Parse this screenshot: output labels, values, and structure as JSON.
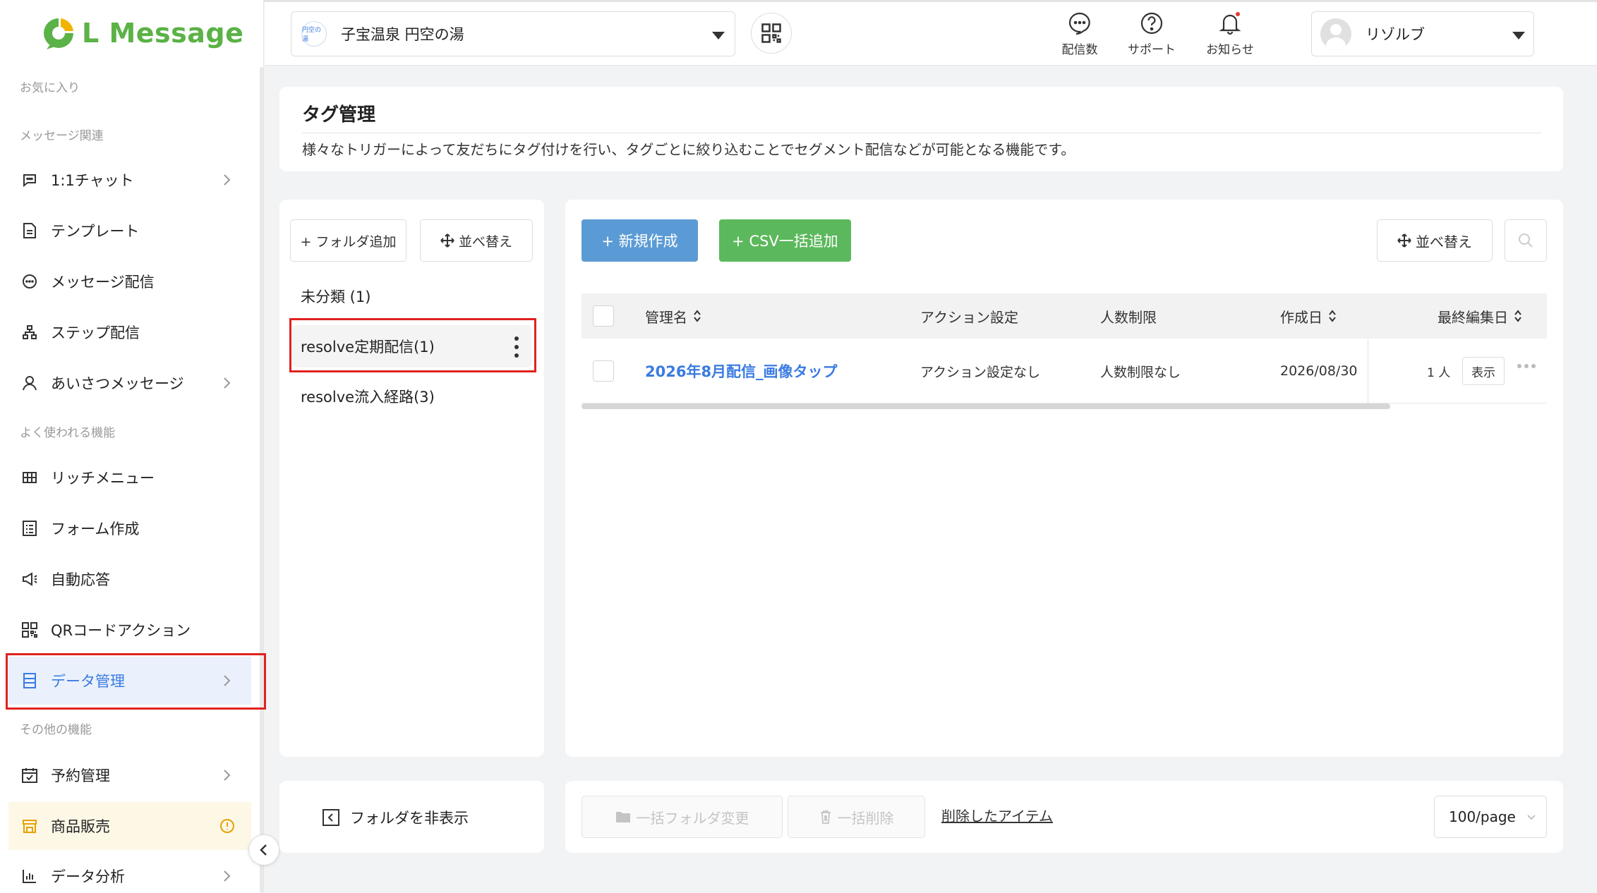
{
  "app": {
    "logo_text": "L Message",
    "brand_color": "#5bb246",
    "accent_color": "#3a7be0"
  },
  "sidebar": {
    "sections": {
      "favorites": "お気に入り",
      "message": "メッセージ関連",
      "frequent": "よく使われる機能",
      "other": "その他の機能"
    },
    "items": [
      {
        "label": "1:1チャット",
        "icon": "chat-icon"
      },
      {
        "label": "テンプレート",
        "icon": "template-icon"
      },
      {
        "label": "メッセージ配信",
        "icon": "message-icon"
      },
      {
        "label": "ステップ配信",
        "icon": "step-icon"
      },
      {
        "label": "あいさつメッセージ",
        "icon": "greeting-icon"
      },
      {
        "label": "リッチメニュー",
        "icon": "rich-menu-icon"
      },
      {
        "label": "フォーム作成",
        "icon": "form-icon"
      },
      {
        "label": "自動応答",
        "icon": "megaphone-icon"
      },
      {
        "label": "QRコードアクション",
        "icon": "qr-icon"
      },
      {
        "label": "データ管理",
        "icon": "data-icon"
      },
      {
        "label": "予約管理",
        "icon": "calendar-icon"
      },
      {
        "label": "商品販売",
        "icon": "shop-icon"
      },
      {
        "label": "データ分析",
        "icon": "chart-icon"
      }
    ]
  },
  "header": {
    "account_name": "子宝温泉 円空の湯",
    "account_logo_text": "円空の湯",
    "icons": [
      {
        "label": "配信数",
        "icon": "message-count-icon"
      },
      {
        "label": "サポート",
        "icon": "help-icon"
      },
      {
        "label": "お知らせ",
        "icon": "bell-icon"
      }
    ],
    "user_name": "リゾルブ"
  },
  "page": {
    "title": "タグ管理",
    "description": "様々なトリガーによって友だちにタグ付けを行い、タグごとに絞り込むことでセグメント配信などが可能となる機能です。"
  },
  "folders": {
    "add_button": "+ フォルダ追加",
    "sort_button": "並べ替え",
    "items": [
      {
        "label": "未分類 (1)"
      },
      {
        "label": "resolve定期配信(1)"
      },
      {
        "label": "resolve流入経路(3)"
      }
    ],
    "hide_label": "フォルダを非表示"
  },
  "toolbar": {
    "new_button": "+ 新規作成",
    "csv_button": "+ CSV一括追加",
    "sort_button": "並べ替え",
    "new_color": "#5b9bd5",
    "csv_color": "#5cb85c"
  },
  "table": {
    "headers": [
      "管理名",
      "アクション設定",
      "人数制限",
      "作成日",
      "最終編集日"
    ],
    "rows": [
      {
        "name": "2026年8月配信_画像タップ",
        "action": "アクション設定なし",
        "limit": "人数制限なし",
        "created": "2026/08/30",
        "count": "1 人",
        "show": "表示"
      }
    ]
  },
  "footer": {
    "bulk_folder": "一括フォルダ変更",
    "bulk_delete": "一括削除",
    "deleted_items": "削除したアイテム",
    "per_page": "100/page"
  }
}
